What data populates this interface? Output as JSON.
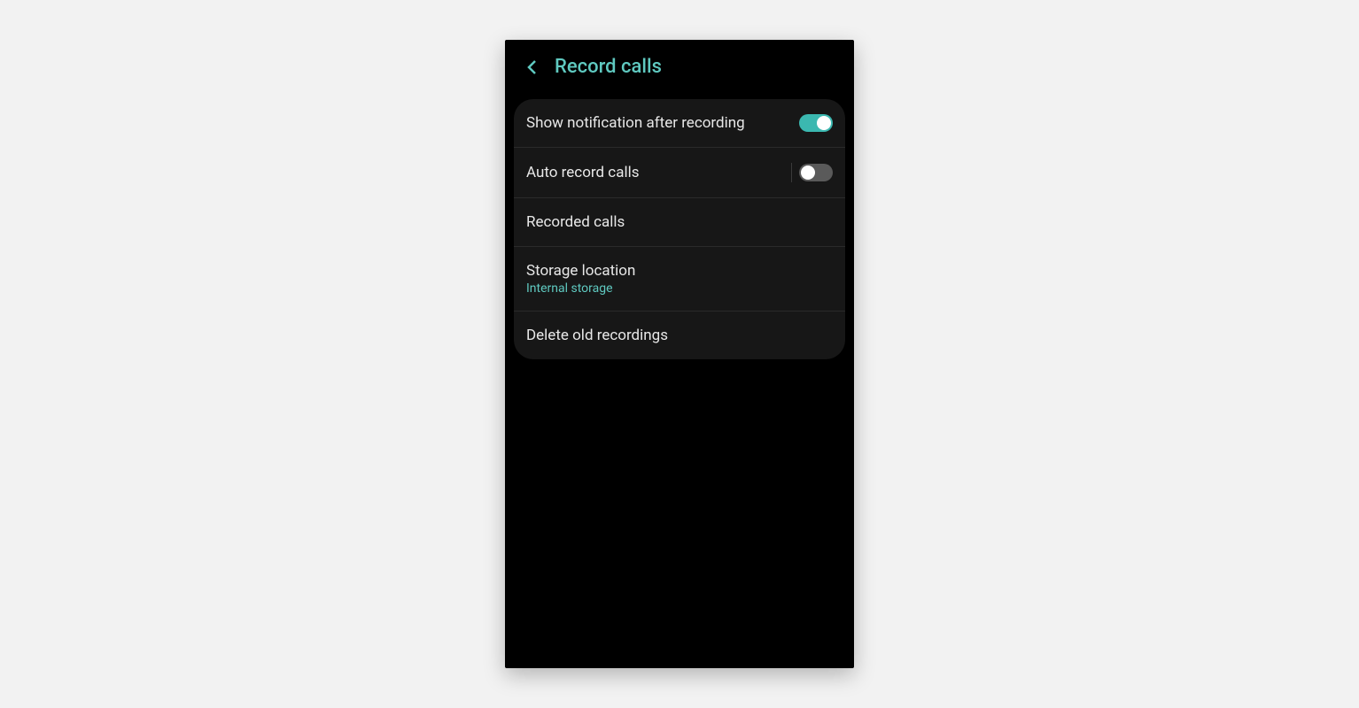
{
  "header": {
    "title": "Record calls"
  },
  "settings": {
    "show_notification": {
      "label": "Show notification after recording",
      "toggle_on": true
    },
    "auto_record": {
      "label": "Auto record calls",
      "toggle_on": false
    },
    "recorded_calls": {
      "label": "Recorded calls"
    },
    "storage_location": {
      "label": "Storage location",
      "value": "Internal storage"
    },
    "delete_old": {
      "label": "Delete old recordings"
    }
  },
  "colors": {
    "accent": "#5fc9c0",
    "toggle_on": "#3bb8b0",
    "toggle_off": "#5a5a5a",
    "background": "#000000",
    "card": "#171717",
    "text": "#e8e8e8"
  }
}
